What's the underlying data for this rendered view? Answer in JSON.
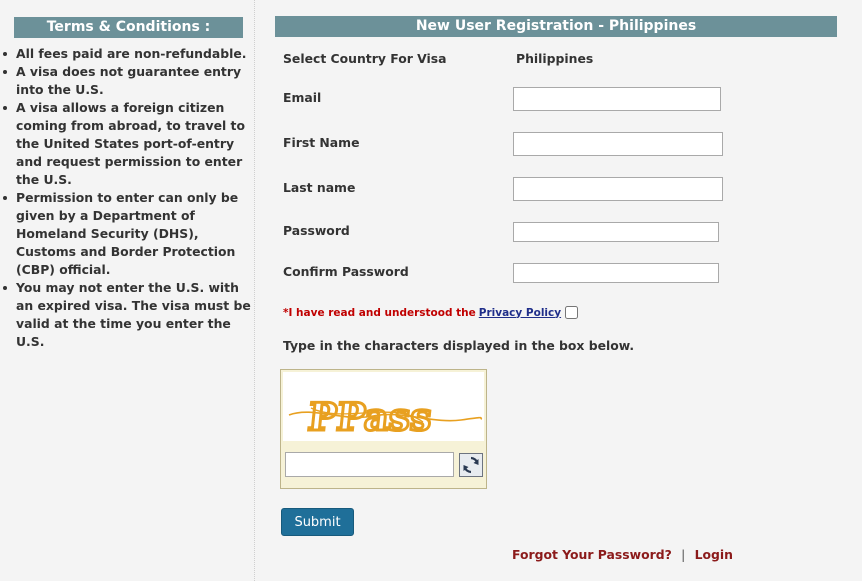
{
  "terms": {
    "title": "Terms & Conditions :",
    "items": [
      "All fees paid are non-refundable.",
      "A visa does not guarantee entry into the U.S.",
      "A visa allows a foreign citizen coming from abroad, to travel to the United States port-of-entry and request permission to enter the U.S.",
      "Permission to enter can only be given by a Department of Homeland Security (DHS), Customs and Border Protection (CBP) official.",
      "You may not enter the U.S. with an expired visa. The visa must be valid at the time you enter the U.S."
    ]
  },
  "registration": {
    "title": "New User Registration - Philippines",
    "country_label": "Select Country For Visa",
    "country_value": "Philippines",
    "email_label": "Email",
    "email_value": "",
    "first_name_label": "First Name",
    "first_name_value": "",
    "last_name_label": "Last name",
    "last_name_value": "",
    "password_label": "Password",
    "password_value": "",
    "confirm_password_label": "Confirm Password",
    "confirm_password_value": "",
    "agree_text": "*I have read and understood the",
    "privacy_link": "Privacy Policy",
    "agree_checked": false,
    "captcha_instruction": "Type in the characters displayed in the box below.",
    "captcha_text": "PPass",
    "captcha_value": "",
    "submit_label": "Submit",
    "forgot_link": "Forgot Your Password?",
    "separator": "|",
    "login_link": "Login"
  },
  "colors": {
    "header_bg": "#6c9199",
    "submit_bg": "#1f6f99",
    "link_red": "#8b1a1a",
    "agree_red": "#c00000",
    "captcha_orange": "#e8a020"
  }
}
